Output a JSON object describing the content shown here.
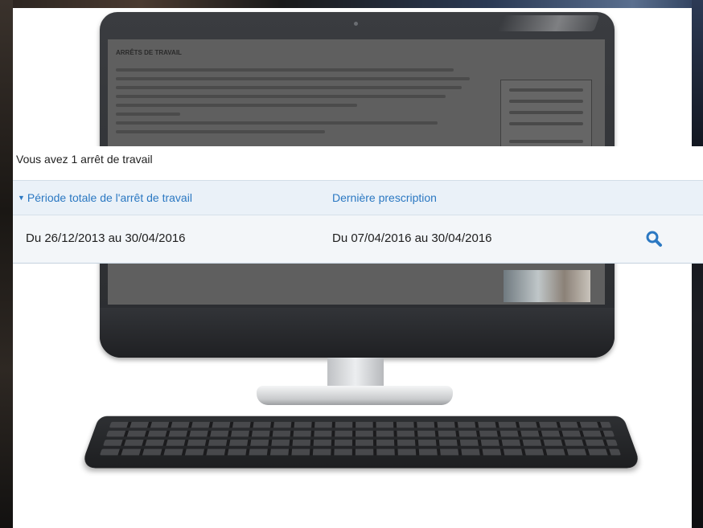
{
  "absence_summary": {
    "count_text": "Vous avez 1 arrêt de travail"
  },
  "table": {
    "columns": [
      {
        "label": "Période totale de l'arrêt de travail",
        "sortable": true,
        "sorted": "desc"
      },
      {
        "label": "Dernière prescription"
      }
    ],
    "rows": [
      {
        "period": "Du 26/12/2013 au 30/04/2016",
        "last_prescription": "Du 07/04/2016 au 30/04/2016",
        "action_icon": "search-icon"
      }
    ]
  },
  "colors": {
    "header_link": "#2b78c2",
    "table_bg": "#eef3f8",
    "icon": "#2b78c2"
  },
  "background_screen": {
    "title": "ARRÊTS DE TRAVAIL"
  }
}
